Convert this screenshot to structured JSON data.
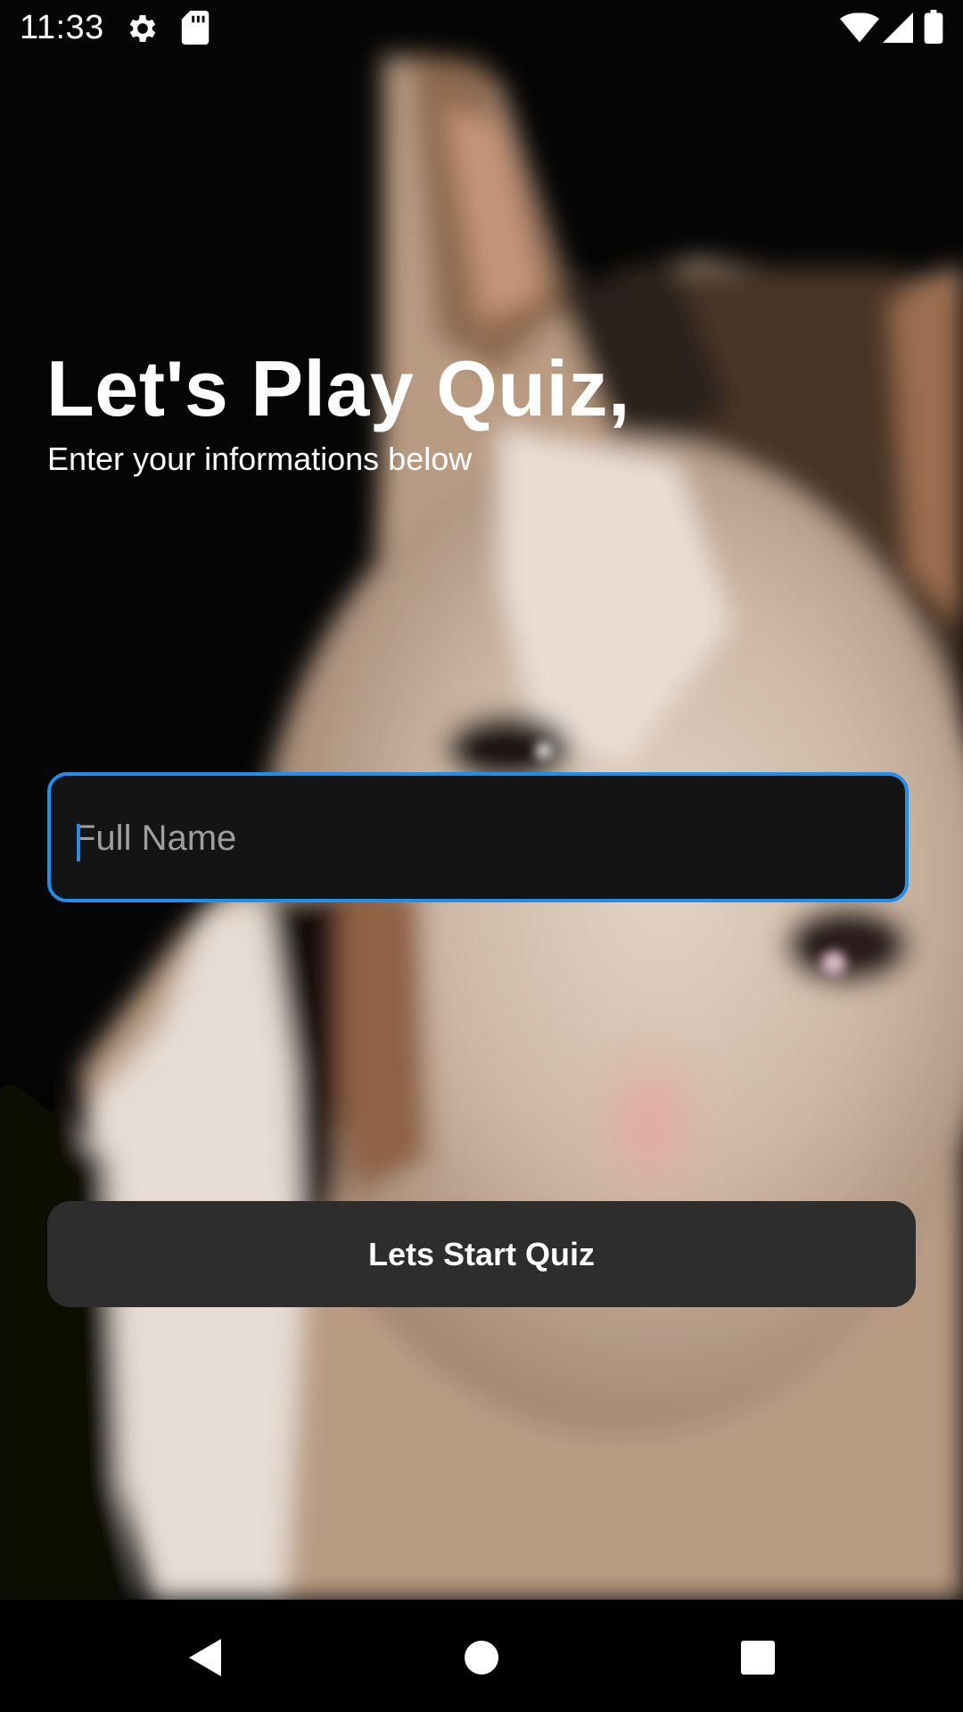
{
  "status_bar": {
    "time": "11:33",
    "icons": [
      "settings-icon",
      "sd-card-icon",
      "wifi-icon",
      "signal-icon",
      "battery-icon"
    ]
  },
  "quiz": {
    "title": "Let's Play Quiz,",
    "subtitle": "Enter your informations below",
    "name_field": {
      "placeholder": "Full Name",
      "value": ""
    },
    "start_label": "Lets Start Quiz"
  },
  "nav_bar": {
    "icons": [
      "back-icon",
      "home-icon",
      "recents-icon"
    ]
  },
  "colors": {
    "accent": "#1f8eed",
    "field_bg": "#141414",
    "button_bg": "#2d2d2d",
    "text": "#ffffff"
  }
}
